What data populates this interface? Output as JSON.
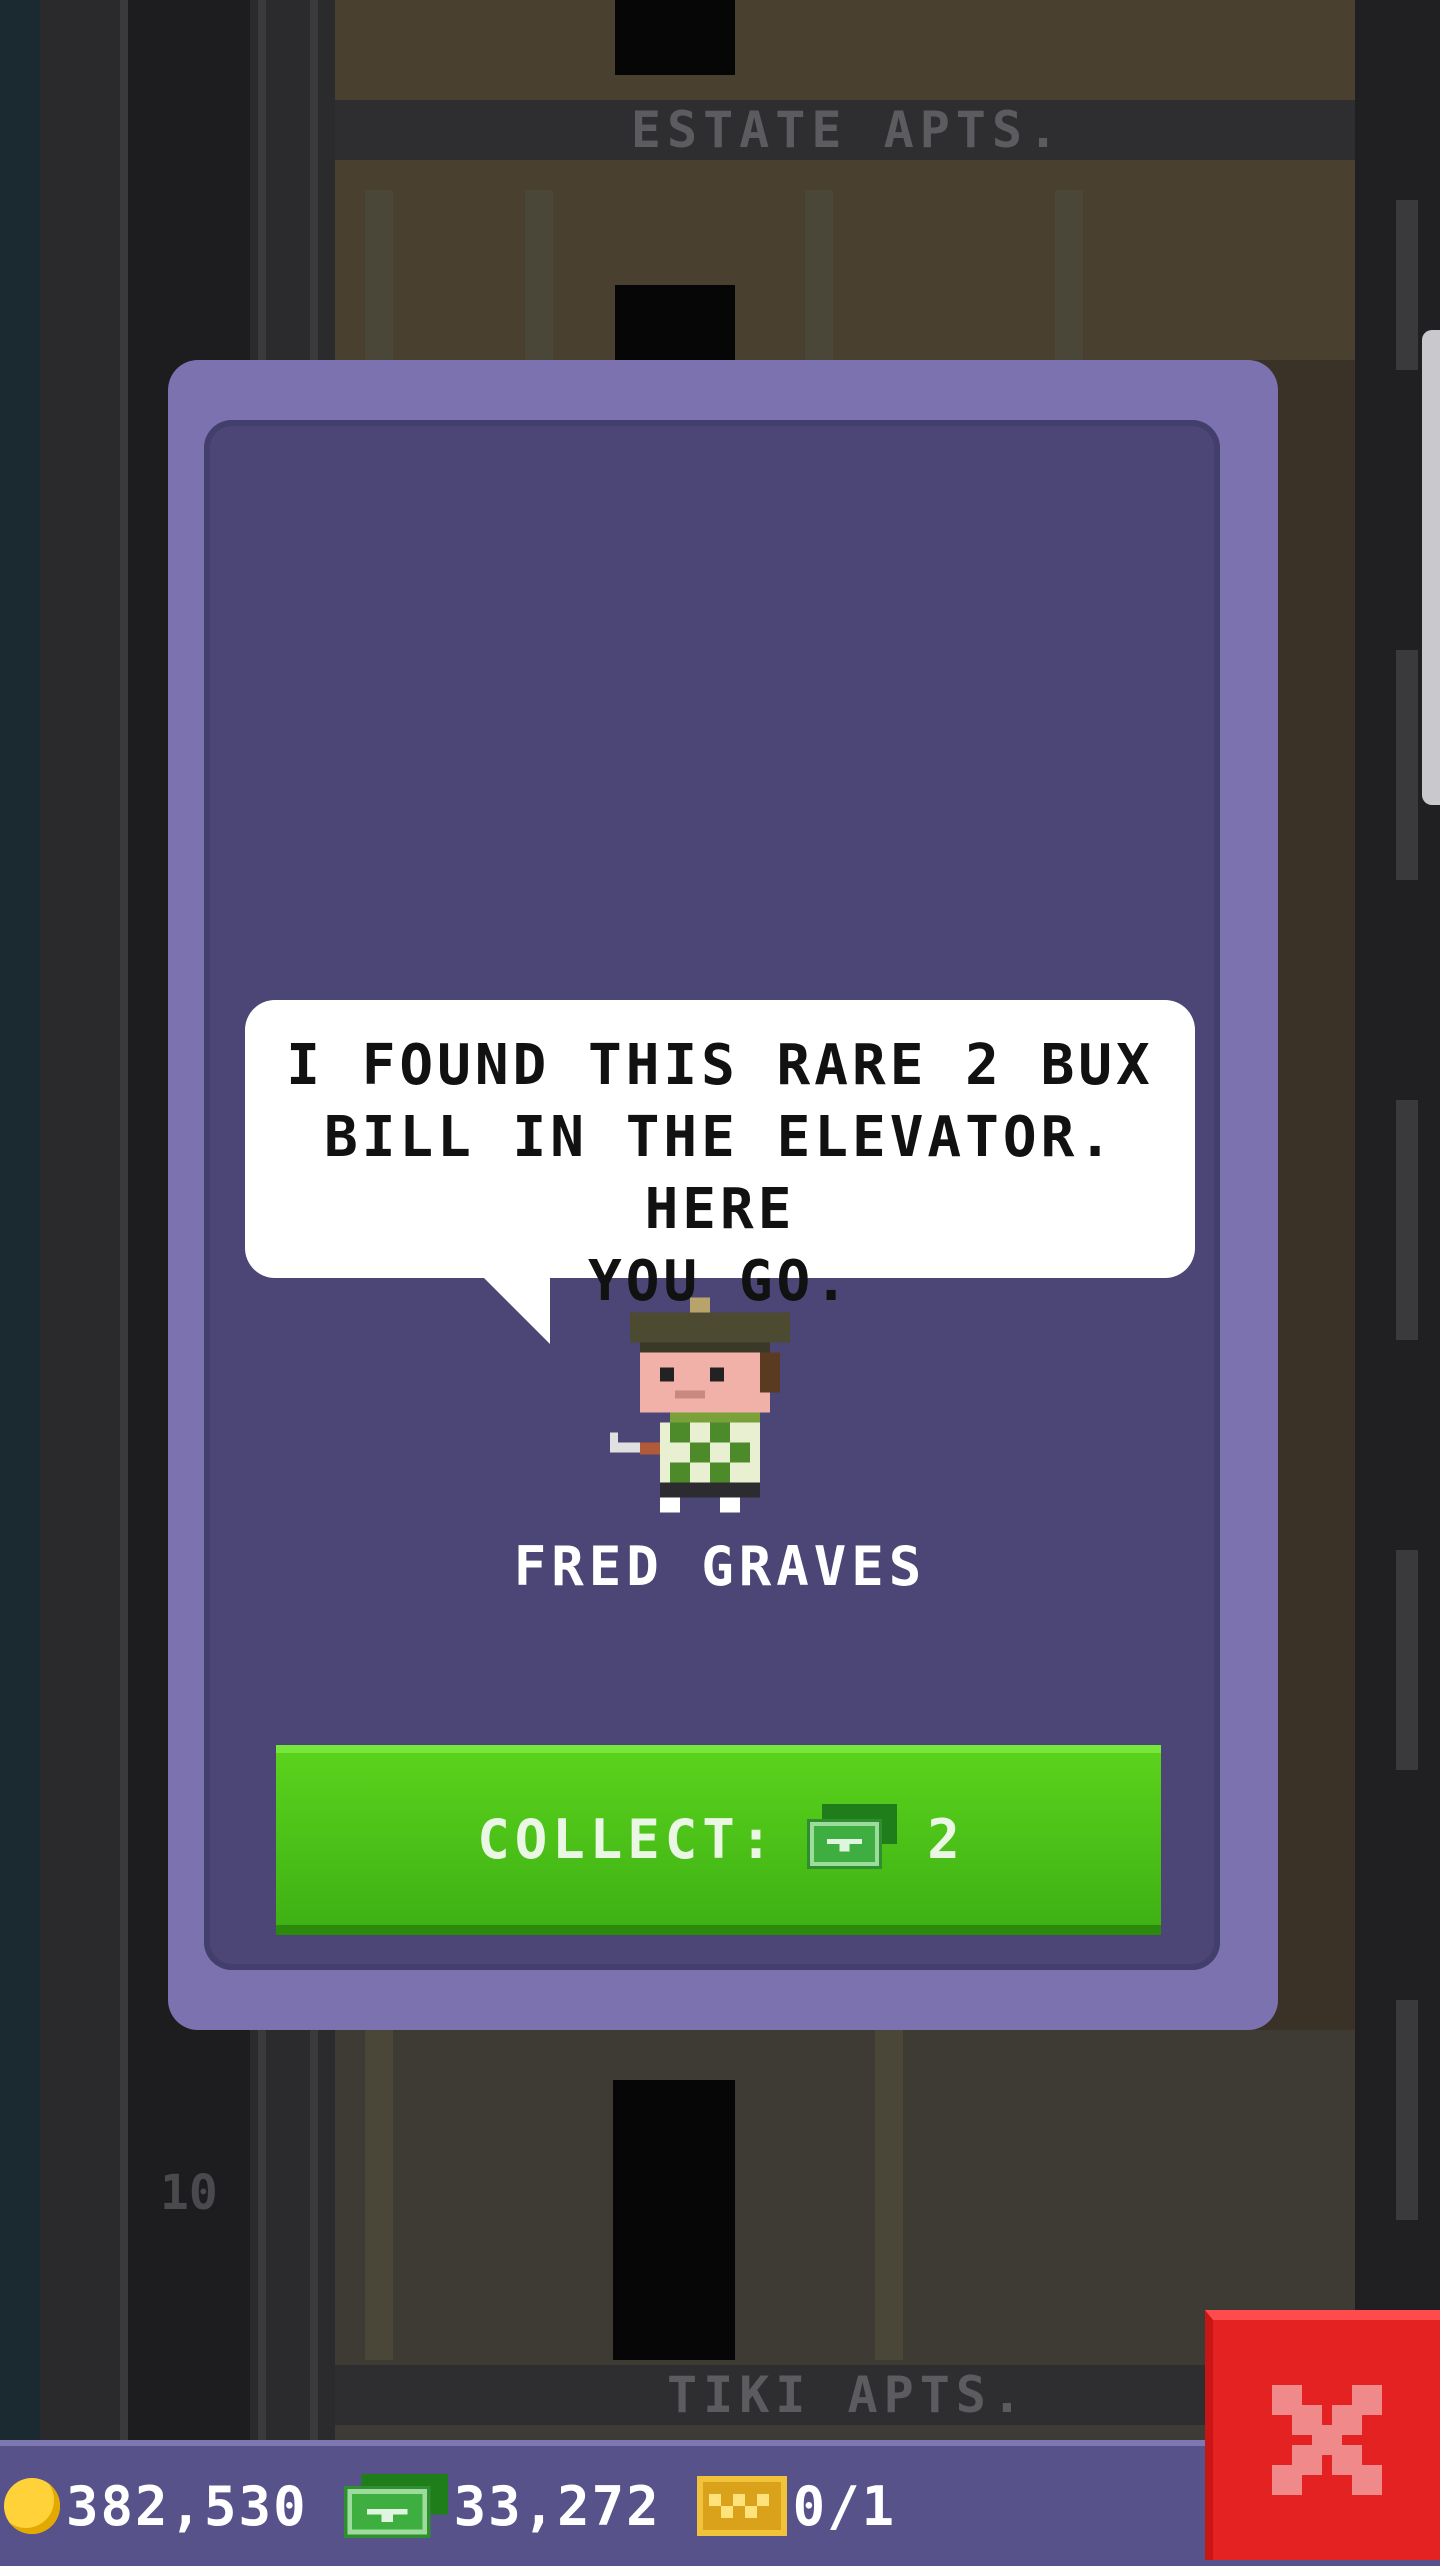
{
  "background": {
    "floor_signs": [
      "ESTATE APTS.",
      "TIKI APTS."
    ],
    "floor_numbers": [
      "10"
    ]
  },
  "dialog": {
    "speech": "I FOUND THIS RARE 2 BUX\nBILL IN THE ELEVATOR. HERE\nYOU GO.",
    "character_name": "FRED GRAVES",
    "collect_label": "COLLECT:",
    "collect_amount": "2",
    "collect_icon": "bux-bill-icon"
  },
  "status_bar": {
    "coins": "382,530",
    "bux": "33,272",
    "vip": "0/1"
  },
  "colors": {
    "modal_border": "#7c72b0",
    "modal_inner": "#4b4676",
    "collect_green": "#4cc318",
    "close_red": "#e52222",
    "status_bar": "#57538a"
  }
}
